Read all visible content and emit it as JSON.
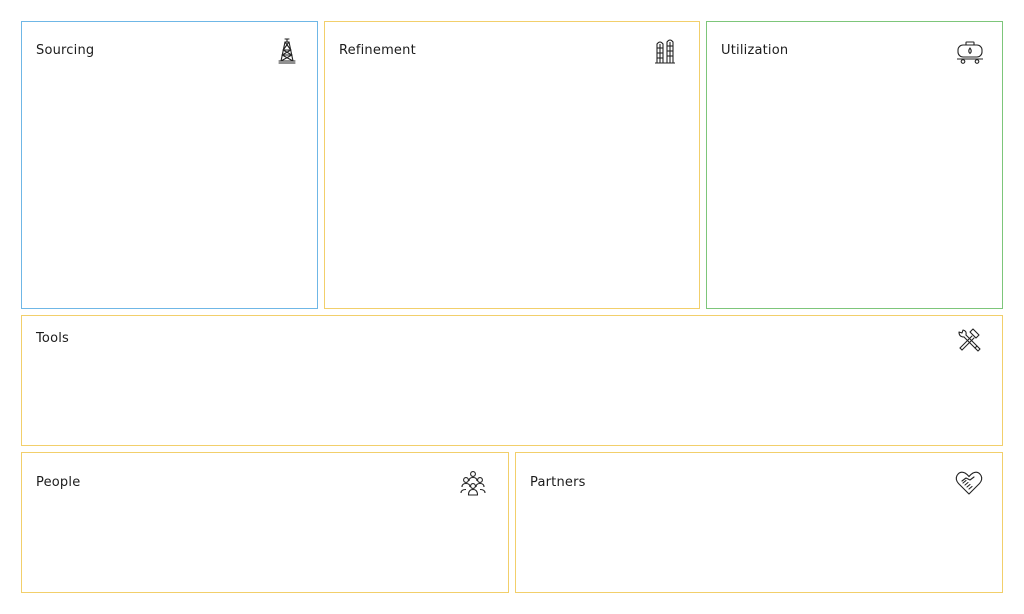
{
  "panels": {
    "sourcing": {
      "title": "Sourcing",
      "icon": "oil-derrick-icon",
      "border_color": "#6fb7e6"
    },
    "refinement": {
      "title": "Refinement",
      "icon": "refinery-towers-icon",
      "border_color": "#f2cf6b"
    },
    "utilization": {
      "title": "Utilization",
      "icon": "oil-tank-wagon-icon",
      "border_color": "#7dc67a"
    },
    "tools": {
      "title": "Tools",
      "icon": "hammer-wrench-icon",
      "border_color": "#f2cf6b"
    },
    "people": {
      "title": "People",
      "icon": "people-group-icon",
      "border_color": "#f2cf6b"
    },
    "partners": {
      "title": "Partners",
      "icon": "handshake-heart-icon",
      "border_color": "#f2cf6b"
    }
  }
}
